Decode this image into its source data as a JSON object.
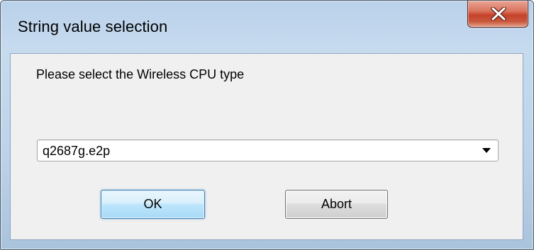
{
  "window": {
    "title": "String value selection"
  },
  "dialog": {
    "prompt": "Please select the Wireless CPU type",
    "combo": {
      "selected_value": "q2687g.e2p",
      "arrow_icon": "chevron-down-icon"
    },
    "buttons": {
      "ok_label": "OK",
      "abort_label": "Abort"
    }
  },
  "colors": {
    "frame": "#bdd3e9",
    "client_bg": "#f0f0f0",
    "close_button": "#c6412a",
    "default_button_border": "#3c7fb1"
  }
}
